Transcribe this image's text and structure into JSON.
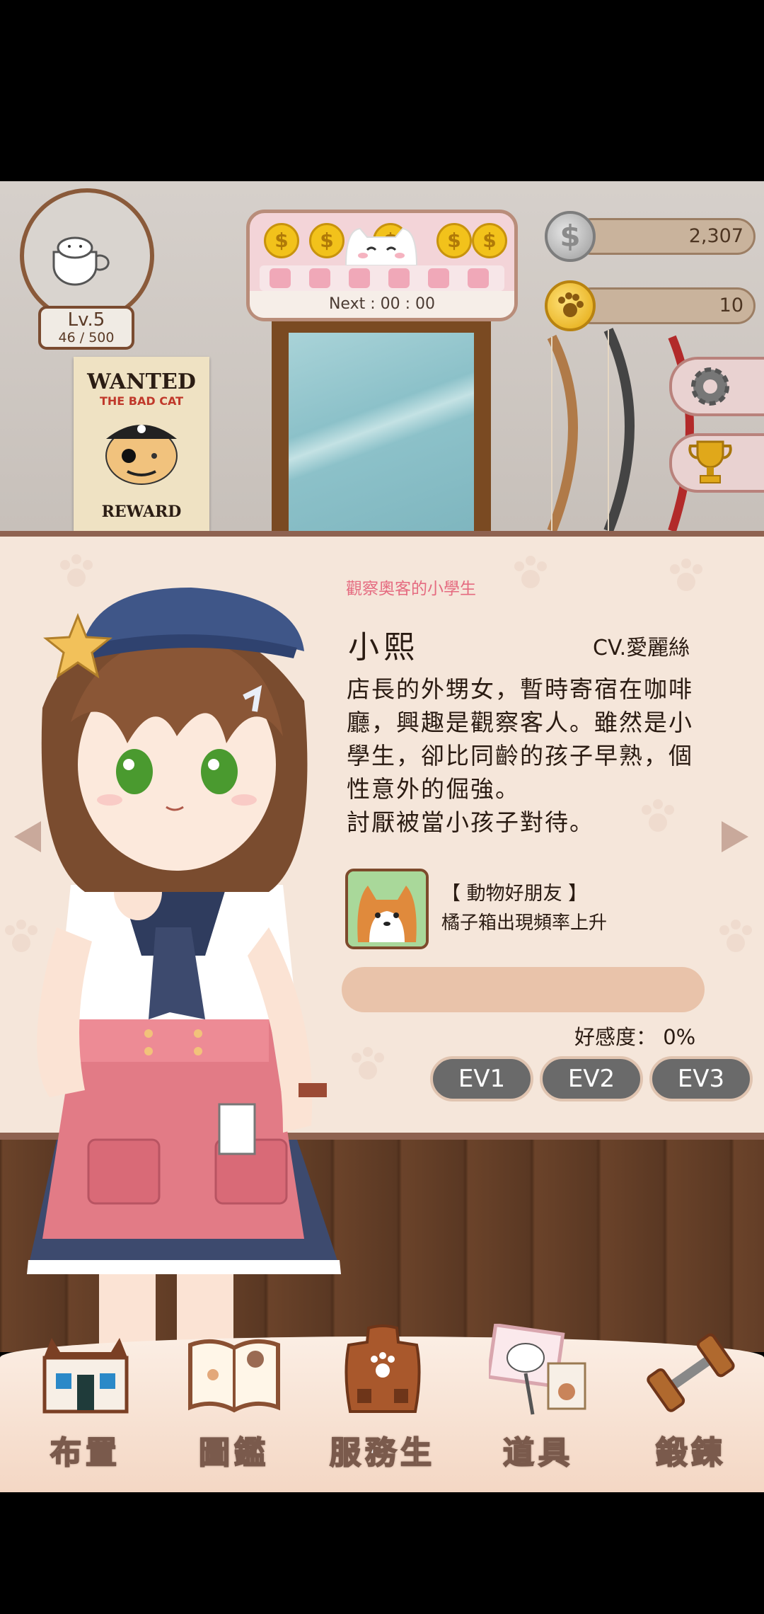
{
  "level": {
    "label": "Lv.5",
    "xp": "46 / 500"
  },
  "poster": {
    "title": "WANTED",
    "subtitle": "THE BAD CAT",
    "reward": "REWARD"
  },
  "coin_machine": {
    "timer": "Next : 00 : 00"
  },
  "currency": {
    "silver": "2,307",
    "gold": "10",
    "silver_symbol": "$"
  },
  "character": {
    "tag": "觀察奧客的小學生",
    "name": "小熙",
    "cv": "CV.愛麗絲",
    "description": [
      "店長的外甥女，暫時寄宿在咖啡",
      "廳，興趣是觀察客人。雖然是小",
      "學生，卻比同齡的孩子早熟，個",
      "性意外的倔強。",
      "討厭被當小孩子對待。"
    ],
    "skill_name": "【 動物好朋友 】",
    "skill_desc": "橘子箱出現頻率上升",
    "favor_label": "好感度： 0%",
    "favor_value": 0
  },
  "ev_buttons": [
    "EV1",
    "EV2",
    "EV3"
  ],
  "nav": [
    {
      "label": "布置",
      "icon": "house-icon"
    },
    {
      "label": "圖鑑",
      "icon": "book-icon"
    },
    {
      "label": "服務生",
      "icon": "apron-icon"
    },
    {
      "label": "道具",
      "icon": "sign-icon"
    },
    {
      "label": "鍛鍊",
      "icon": "dumbbell-icon"
    }
  ],
  "colors": {
    "panel": "#f5e6da",
    "accent_tag": "#e56b80",
    "frame": "#8e6250",
    "ev_button": "#6a6a6a"
  }
}
